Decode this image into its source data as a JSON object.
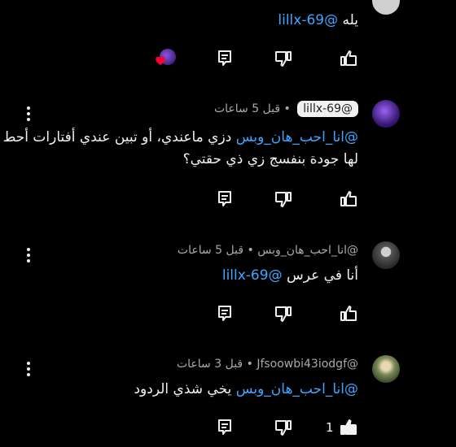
{
  "comments": [
    {
      "body_text": "يله ",
      "mention": "@lillx-69",
      "reply_label": "Reply",
      "like_count": ""
    },
    {
      "author": "@lillx-69",
      "time": "قبل 5 ساعات",
      "mention": "@انا_احب_هان_وبس",
      "body_rest": " دزي ماعندي، أو تبين عندي أفتارات أحط لها جودة بنفسج زي ذي حقتي؟",
      "like_count": ""
    },
    {
      "author": "@انا_احب_هان_وبس",
      "time": "قبل 5 ساعات",
      "body_text": "أنا في عرس ",
      "mention": "@lillx-69",
      "like_count": ""
    },
    {
      "author": "@Jfsoowbi43iodgf",
      "time": "قبل 3 ساعات",
      "mention": "@انا_احب_هان_وبس",
      "body_rest": " يخي شذي الردود",
      "like_count": "1"
    }
  ],
  "colors": {
    "mention": "#3ea6ff",
    "background": "#000000",
    "heart": "#ff0033"
  }
}
